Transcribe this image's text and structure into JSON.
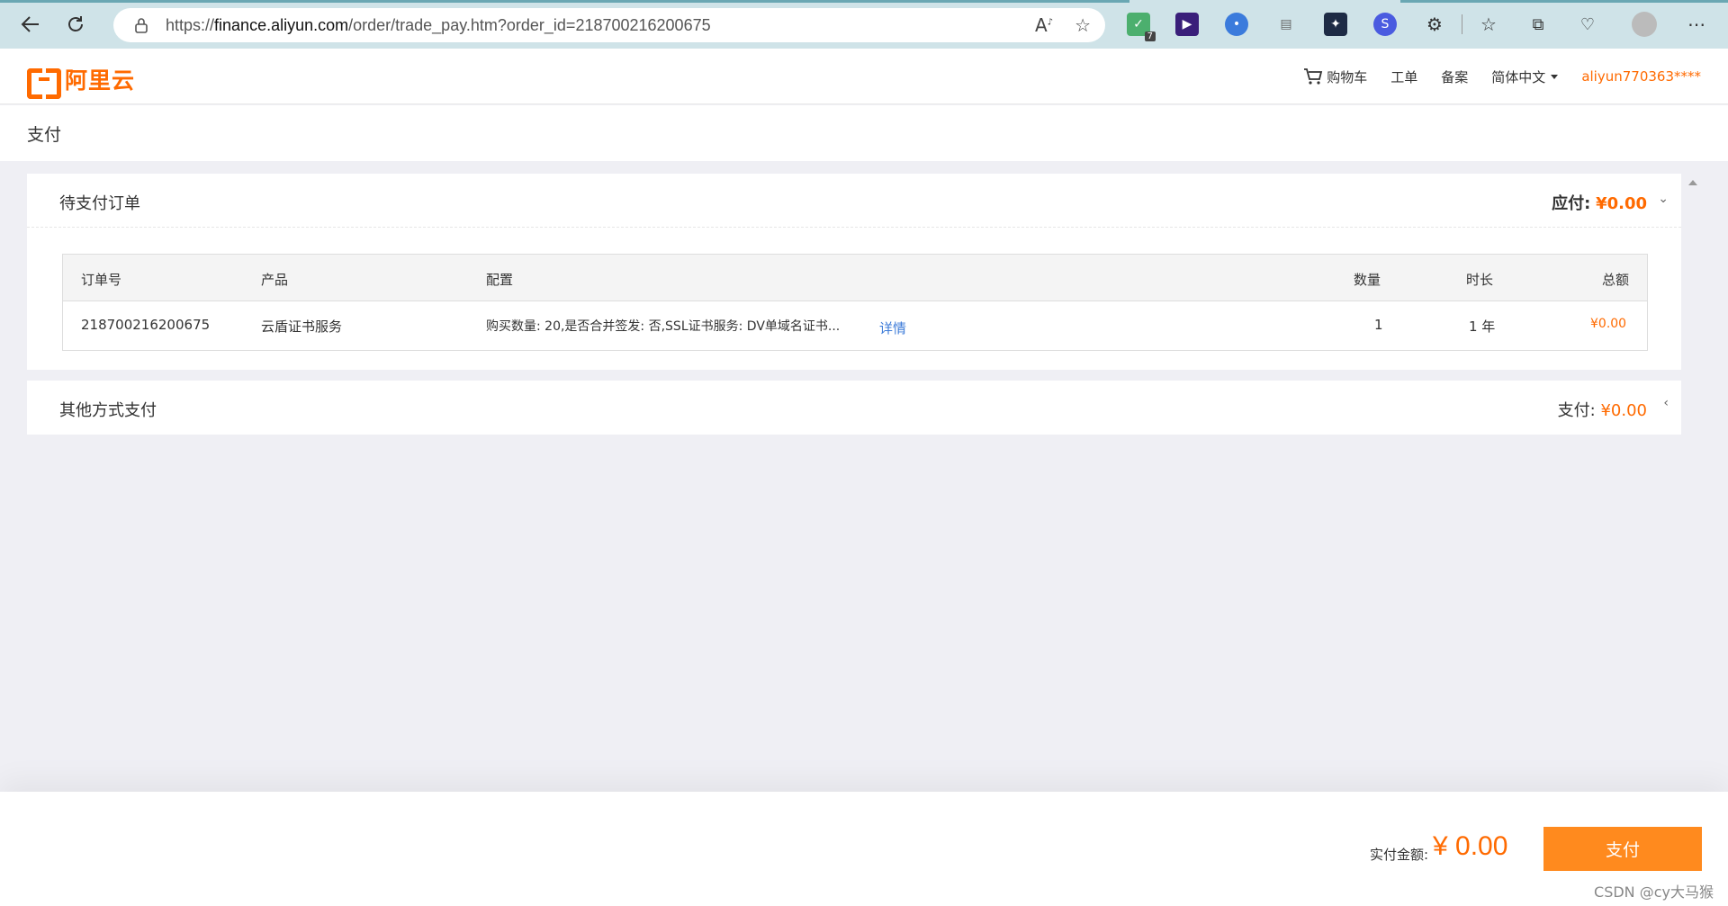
{
  "browser": {
    "url_prefix": "https://",
    "url_domain": "finance.aliyun.com",
    "url_path": "/order/trade_pay.htm?order_id=218700216200675",
    "extension_badge": "7"
  },
  "header": {
    "logo_text": "阿里云",
    "cart": "购物车",
    "ticket": "工单",
    "filing": "备案",
    "language": "简体中文",
    "user": "aliyun770363****"
  },
  "page_title": "支付",
  "pending_panel": {
    "title": "待支付订单",
    "due_label": "应付:",
    "due_value": "¥0.00",
    "columns": {
      "order_no": "订单号",
      "product": "产品",
      "config": "配置",
      "qty": "数量",
      "duration": "时长",
      "total": "总额"
    },
    "rows": [
      {
        "order_no": "218700216200675",
        "product": "云盾证书服务",
        "config": "购买数量: 20,是否合并签发: 否,SSL证书服务: DV单域名证书...",
        "detail_link": "详情",
        "qty": "1",
        "duration": "1 年",
        "total": "¥0.00"
      }
    ]
  },
  "other_panel": {
    "title": "其他方式支付",
    "pay_label": "支付:",
    "pay_value": "¥0.00"
  },
  "footer": {
    "amount_label": "实付金额:",
    "amount_value": "¥ 0.00",
    "pay_button": "支付",
    "watermark": "CSDN @cy大马猴"
  }
}
